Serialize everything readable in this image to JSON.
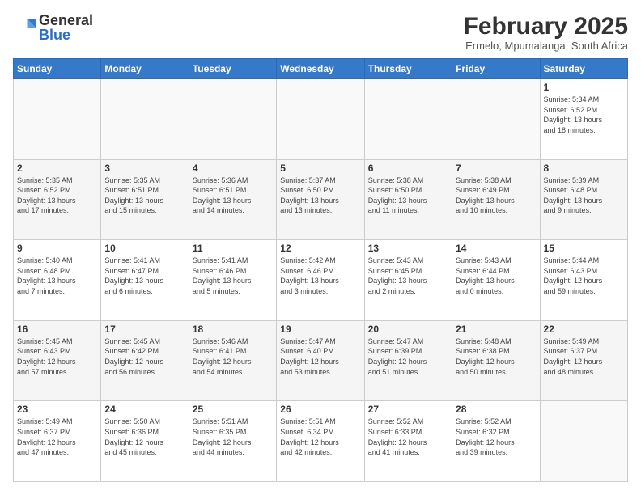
{
  "logo": {
    "general": "General",
    "blue": "Blue"
  },
  "header": {
    "month": "February 2025",
    "location": "Ermelo, Mpumalanga, South Africa"
  },
  "weekdays": [
    "Sunday",
    "Monday",
    "Tuesday",
    "Wednesday",
    "Thursday",
    "Friday",
    "Saturday"
  ],
  "weeks": [
    [
      {
        "day": "",
        "info": ""
      },
      {
        "day": "",
        "info": ""
      },
      {
        "day": "",
        "info": ""
      },
      {
        "day": "",
        "info": ""
      },
      {
        "day": "",
        "info": ""
      },
      {
        "day": "",
        "info": ""
      },
      {
        "day": "1",
        "info": "Sunrise: 5:34 AM\nSunset: 6:52 PM\nDaylight: 13 hours\nand 18 minutes."
      }
    ],
    [
      {
        "day": "2",
        "info": "Sunrise: 5:35 AM\nSunset: 6:52 PM\nDaylight: 13 hours\nand 17 minutes."
      },
      {
        "day": "3",
        "info": "Sunrise: 5:35 AM\nSunset: 6:51 PM\nDaylight: 13 hours\nand 15 minutes."
      },
      {
        "day": "4",
        "info": "Sunrise: 5:36 AM\nSunset: 6:51 PM\nDaylight: 13 hours\nand 14 minutes."
      },
      {
        "day": "5",
        "info": "Sunrise: 5:37 AM\nSunset: 6:50 PM\nDaylight: 13 hours\nand 13 minutes."
      },
      {
        "day": "6",
        "info": "Sunrise: 5:38 AM\nSunset: 6:50 PM\nDaylight: 13 hours\nand 11 minutes."
      },
      {
        "day": "7",
        "info": "Sunrise: 5:38 AM\nSunset: 6:49 PM\nDaylight: 13 hours\nand 10 minutes."
      },
      {
        "day": "8",
        "info": "Sunrise: 5:39 AM\nSunset: 6:48 PM\nDaylight: 13 hours\nand 9 minutes."
      }
    ],
    [
      {
        "day": "9",
        "info": "Sunrise: 5:40 AM\nSunset: 6:48 PM\nDaylight: 13 hours\nand 7 minutes."
      },
      {
        "day": "10",
        "info": "Sunrise: 5:41 AM\nSunset: 6:47 PM\nDaylight: 13 hours\nand 6 minutes."
      },
      {
        "day": "11",
        "info": "Sunrise: 5:41 AM\nSunset: 6:46 PM\nDaylight: 13 hours\nand 5 minutes."
      },
      {
        "day": "12",
        "info": "Sunrise: 5:42 AM\nSunset: 6:46 PM\nDaylight: 13 hours\nand 3 minutes."
      },
      {
        "day": "13",
        "info": "Sunrise: 5:43 AM\nSunset: 6:45 PM\nDaylight: 13 hours\nand 2 minutes."
      },
      {
        "day": "14",
        "info": "Sunrise: 5:43 AM\nSunset: 6:44 PM\nDaylight: 13 hours\nand 0 minutes."
      },
      {
        "day": "15",
        "info": "Sunrise: 5:44 AM\nSunset: 6:43 PM\nDaylight: 12 hours\nand 59 minutes."
      }
    ],
    [
      {
        "day": "16",
        "info": "Sunrise: 5:45 AM\nSunset: 6:43 PM\nDaylight: 12 hours\nand 57 minutes."
      },
      {
        "day": "17",
        "info": "Sunrise: 5:45 AM\nSunset: 6:42 PM\nDaylight: 12 hours\nand 56 minutes."
      },
      {
        "day": "18",
        "info": "Sunrise: 5:46 AM\nSunset: 6:41 PM\nDaylight: 12 hours\nand 54 minutes."
      },
      {
        "day": "19",
        "info": "Sunrise: 5:47 AM\nSunset: 6:40 PM\nDaylight: 12 hours\nand 53 minutes."
      },
      {
        "day": "20",
        "info": "Sunrise: 5:47 AM\nSunset: 6:39 PM\nDaylight: 12 hours\nand 51 minutes."
      },
      {
        "day": "21",
        "info": "Sunrise: 5:48 AM\nSunset: 6:38 PM\nDaylight: 12 hours\nand 50 minutes."
      },
      {
        "day": "22",
        "info": "Sunrise: 5:49 AM\nSunset: 6:37 PM\nDaylight: 12 hours\nand 48 minutes."
      }
    ],
    [
      {
        "day": "23",
        "info": "Sunrise: 5:49 AM\nSunset: 6:37 PM\nDaylight: 12 hours\nand 47 minutes."
      },
      {
        "day": "24",
        "info": "Sunrise: 5:50 AM\nSunset: 6:36 PM\nDaylight: 12 hours\nand 45 minutes."
      },
      {
        "day": "25",
        "info": "Sunrise: 5:51 AM\nSunset: 6:35 PM\nDaylight: 12 hours\nand 44 minutes."
      },
      {
        "day": "26",
        "info": "Sunrise: 5:51 AM\nSunset: 6:34 PM\nDaylight: 12 hours\nand 42 minutes."
      },
      {
        "day": "27",
        "info": "Sunrise: 5:52 AM\nSunset: 6:33 PM\nDaylight: 12 hours\nand 41 minutes."
      },
      {
        "day": "28",
        "info": "Sunrise: 5:52 AM\nSunset: 6:32 PM\nDaylight: 12 hours\nand 39 minutes."
      },
      {
        "day": "",
        "info": ""
      }
    ]
  ]
}
